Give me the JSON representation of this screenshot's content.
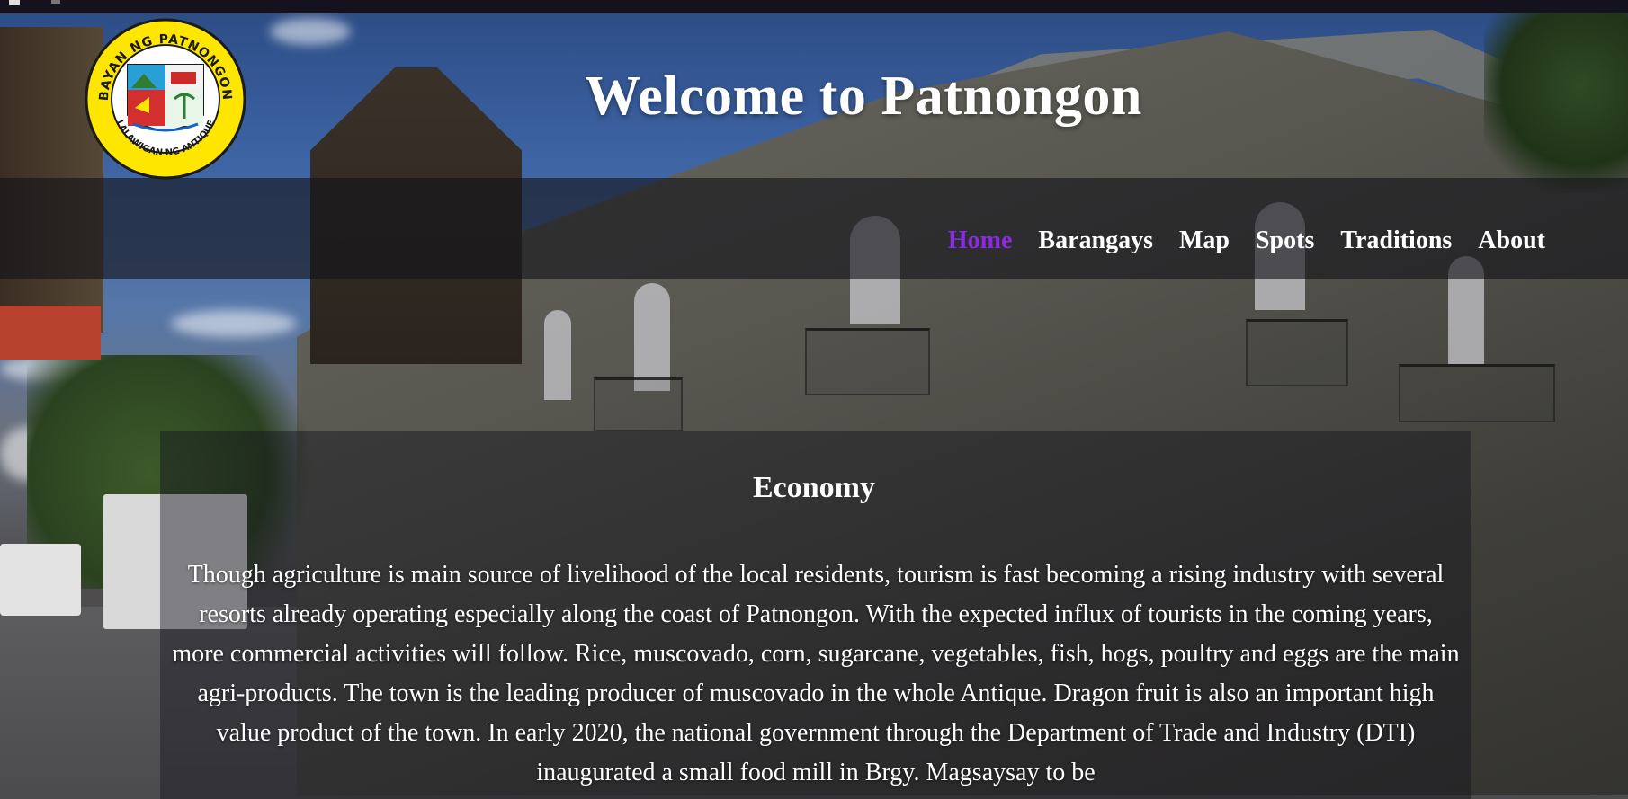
{
  "header": {
    "title": "Welcome to Patnongon",
    "logo": {
      "top_text": "BAYAN NG PATNONGON",
      "bottom_text": "LALAWIGAN NG ANTIQUE"
    }
  },
  "nav": {
    "items": [
      {
        "label": "Home",
        "active": true
      },
      {
        "label": "Barangays",
        "active": false
      },
      {
        "label": "Map",
        "active": false
      },
      {
        "label": "Spots",
        "active": false
      },
      {
        "label": "Traditions",
        "active": false
      },
      {
        "label": "About",
        "active": false
      }
    ],
    "active_color": "#8a2be2",
    "text_color": "#ffffff"
  },
  "content": {
    "title": "Economy",
    "body": "Though agriculture is main source of livelihood of the local residents, tourism is fast becoming a rising industry with several resorts already operating especially along the coast of Patnongon. With the expected influx of tourists in the coming years, more commercial activities will follow. Rice, muscovado, corn, sugarcane, vegetables, fish, hogs, poultry and eggs are the main agri-products. The town is the leading producer of muscovado in the whole Antique. Dragon fruit is also an important high value product of the town. In early 2020, the national government through the Department of Trade and Industry (DTI) inaugurated a small food mill in Brgy. Magsaysay to be"
  }
}
